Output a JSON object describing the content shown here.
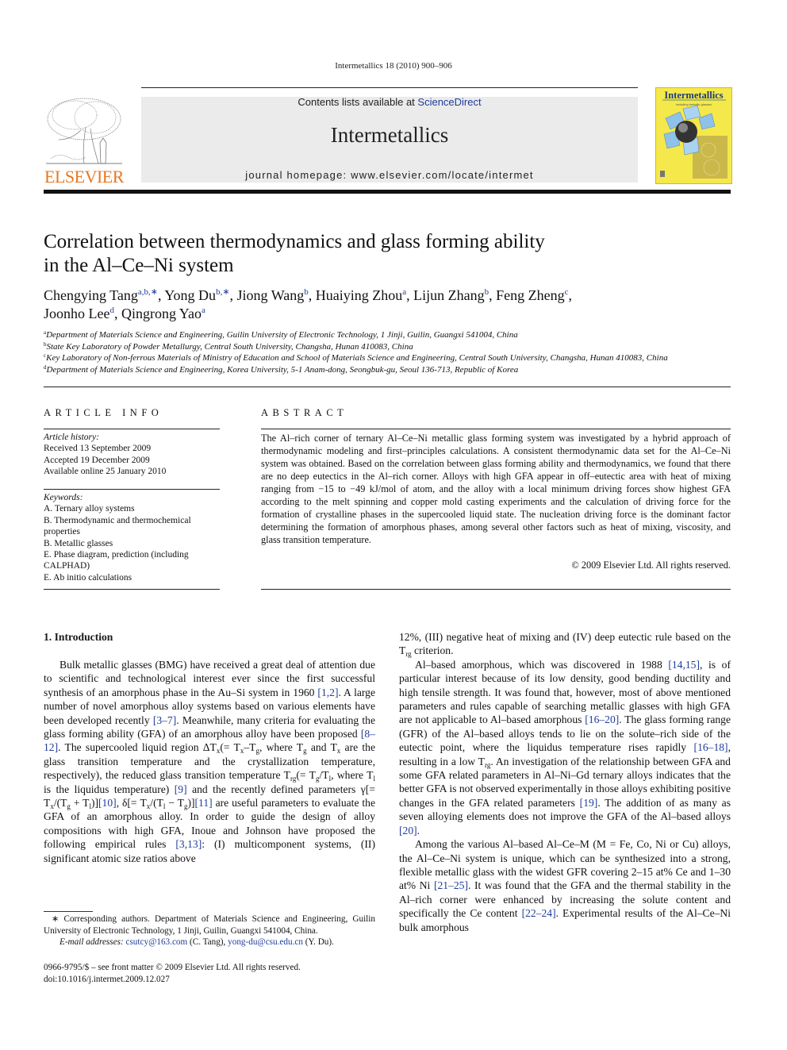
{
  "header": {
    "running_head": "Intermetallics 18 (2010) 900–906",
    "contents_prefix": "Contents lists available at ",
    "contents_link": "ScienceDirect",
    "journal_name": "Intermetallics",
    "homepage_prefix": "journal homepage: ",
    "homepage_url": "www.elsevier.com/locate/intermet",
    "publisher_logo_text": "ELSEVIER",
    "cover_title": "Intermetallics",
    "cover_subtitle": "including metallic glasses",
    "colors": {
      "publisher_orange": "#e87722",
      "link_blue": "#1f3d9a",
      "cover_yellow": "#f5e84a",
      "banner_gray": "#ebebeb"
    }
  },
  "article": {
    "title_line1": "Correlation between thermodynamics and glass forming ability",
    "title_line2": "in the Al–Ce–Ni system",
    "authors": [
      {
        "name": "Chengying Tang",
        "sup": "a,b,∗",
        "sep": ", "
      },
      {
        "name": "Yong Du",
        "sup": "b,∗",
        "sep": ", "
      },
      {
        "name": "Jiong Wang",
        "sup": "b",
        "sep": ", "
      },
      {
        "name": "Huaiying Zhou",
        "sup": "a",
        "sep": ", "
      },
      {
        "name": "Lijun Zhang",
        "sup": "b",
        "sep": ", "
      },
      {
        "name": "Feng Zheng",
        "sup": "c",
        "sep": ","
      },
      {
        "name": "Joonho Lee",
        "sup": "d",
        "sep": ", "
      },
      {
        "name": "Qingrong Yao",
        "sup": "a",
        "sep": ""
      }
    ],
    "affiliations": [
      {
        "key": "a",
        "text": "Department of Materials Science and Engineering, Guilin University of Electronic Technology, 1 Jinji, Guilin, Guangxi 541004, China"
      },
      {
        "key": "b",
        "text": "State Key Laboratory of Powder Metallurgy, Central South University, Changsha, Hunan 410083, China"
      },
      {
        "key": "c",
        "text": "Key Laboratory of Non-ferrous Materials of Ministry of Education and School of Materials Science and Engineering, Central South University, Changsha, Hunan 410083, China"
      },
      {
        "key": "d",
        "text": "Department of Materials Science and Engineering, Korea University, 5-1 Anam-dong, Seongbuk-gu, Seoul 136-713, Republic of Korea"
      }
    ]
  },
  "article_info": {
    "heading": "ARTICLE INFO",
    "history_label": "Article history:",
    "received": "Received 13 September 2009",
    "accepted": "Accepted 19 December 2009",
    "online": "Available online 25 January 2010",
    "keywords_label": "Keywords:",
    "keywords": [
      "A. Ternary alloy systems",
      "B. Thermodynamic and thermochemical properties",
      "B. Metallic glasses",
      "E. Phase diagram, prediction (including CALPHAD)",
      "E. Ab initio calculations"
    ]
  },
  "abstract": {
    "heading": "ABSTRACT",
    "text": "The Al–rich corner of ternary Al–Ce–Ni metallic glass forming system was investigated by a hybrid approach of thermodynamic modeling and first–principles calculations. A consistent thermodynamic data set for the Al–Ce–Ni system was obtained. Based on the correlation between glass forming ability and thermodynamics, we found that there are no deep eutectics in the Al–rich corner. Alloys with high GFA appear in off–eutectic area with heat of mixing ranging from −15 to −49 kJ/mol of atom, and the alloy with a local minimum driving forces show highest GFA according to the melt spinning and copper mold casting experiments and the calculation of driving force for the formation of crystalline phases in the supercooled liquid state. The nucleation driving force is the dominant factor determining the formation of amorphous phases, among several other factors such as heat of mixing, viscosity, and glass transition temperature.",
    "copyright": "© 2009 Elsevier Ltd. All rights reserved."
  },
  "body": {
    "section_heading": "1.  Introduction",
    "left": {
      "p1_a": "Bulk metallic glasses (BMG) have received a great deal of attention due to scientific and technological interest ever since the first successful synthesis of an amorphous phase in the Au–Si system in 1960 ",
      "ref_1_2": "[1,2]",
      "p1_b": ". A large number of novel amorphous alloy systems based on various elements have been developed recently ",
      "ref_3_7": "[3–7]",
      "p1_c": ". Meanwhile, many criteria for evaluating the glass forming ability (GFA) of an amorphous alloy have been proposed ",
      "ref_8_12": "[8–12]",
      "p1_d": ". The supercooled liquid region ΔT",
      "p1_e": "(= T",
      "p1_f": "–T",
      "p1_g": ", where T",
      "p1_h": " and T",
      "p1_i": " are the glass transition temperature and the crystallization temperature, respectively), the reduced glass transition temperature T",
      "p1_j": "(= T",
      "p1_k": "/T",
      "p1_l": ", where T",
      "p1_m": " is the liquidus temperature) ",
      "ref_9": "[9]",
      "p1_n": " and the recently defined parameters γ[= T",
      "p1_o": "/(T",
      "p1_p": " + T",
      "p1_q": ")]",
      "ref_10": "[10]",
      "p1_r": ", δ[= T",
      "p1_s": "/(T",
      "p1_t": " − T",
      "p1_u": ")]",
      "ref_11": "[11]",
      "p1_v": " are useful parameters to evaluate the GFA of an amorphous alloy. In order to guide the design of alloy compositions with high GFA, Inoue and Johnson have proposed the following empirical rules ",
      "ref_3_13": "[3,13]",
      "p1_w": ": (I) multicomponent systems, (II) significant atomic size ratios above",
      "sub_x": "x",
      "sub_g": "g",
      "sub_rg": "rg",
      "sub_l": "l"
    },
    "right": {
      "p0_a": "12%, (III) negative heat of mixing and (IV) deep eutectic rule based on the T",
      "p0_b": " criterion.",
      "p2_a": "Al–based amorphous, which was discovered in 1988 ",
      "ref_14_15": "[14,15]",
      "p2_b": ", is of particular interest because of its low density, good bending ductility and high tensile strength. It was found that, however, most of above mentioned parameters and rules capable of searching metallic glasses with high GFA are not applicable to Al–based amorphous ",
      "ref_16_20": "[16–20]",
      "p2_c": ". The glass forming range (GFR) of the Al–based alloys tends to lie on the solute–rich side of the eutectic point, where the liquidus temperature rises rapidly ",
      "ref_16_18": "[16–18]",
      "p2_d": ", resulting in a low T",
      "p2_e": ". An investigation of the relationship between GFA and some GFA related parameters in Al–Ni–Gd ternary alloys indicates that the better GFA is not observed experimentally in those alloys exhibiting positive changes in the GFA related parameters ",
      "ref_19": "[19]",
      "p2_f": ". The addition of as many as seven alloying elements does not improve the GFA of the Al–based alloys ",
      "ref_20": "[20]",
      "p2_g": ".",
      "p3_a": "Among the various Al–based Al–Ce–M (M = Fe, Co, Ni or Cu) alloys, the Al–Ce–Ni system is unique, which can be synthesized into a strong, flexible metallic glass with the widest GFR covering 2–15 at% Ce and 1–30 at% Ni ",
      "ref_21_25": "[21–25]",
      "p3_b": ". It was found that the GFA and the thermal stability in the Al–rich corner were enhanced by increasing the solute content and specifically the Ce content ",
      "ref_22_24": "[22–24]",
      "p3_c": ". Experimental results of the Al–Ce–Ni bulk amorphous"
    }
  },
  "footnote": {
    "corresponding": "∗ Corresponding authors. Department of Materials Science and Engineering, Guilin University of Electronic Technology, 1 Jinji, Guilin, Guangxi 541004, China.",
    "email_label": "E-mail addresses: ",
    "email1": "csutcy@163.com",
    "email1_owner": " (C. Tang), ",
    "email2": "yong-du@csu.edu.cn",
    "email2_owner": " (Y. Du)."
  },
  "front_matter": {
    "issn_line": "0966-9795/$ – see front matter © 2009 Elsevier Ltd. All rights reserved.",
    "doi": "doi:10.1016/j.intermet.2009.12.027"
  }
}
